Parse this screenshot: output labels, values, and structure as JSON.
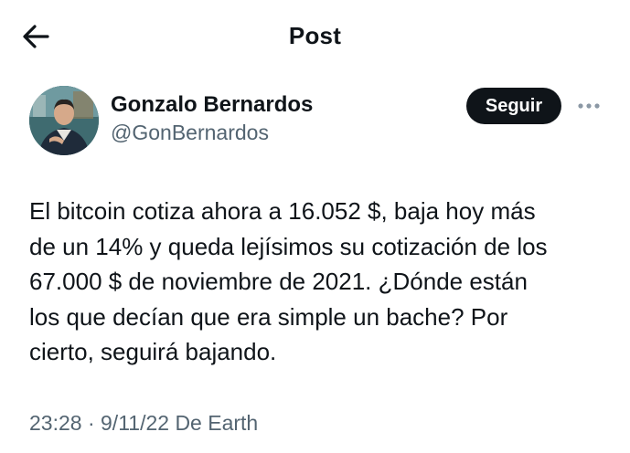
{
  "header": {
    "title": "Post",
    "back_icon": "arrow-left-icon"
  },
  "author": {
    "display_name": "Gonzalo Bernardos",
    "handle": "@GonBernardos",
    "follow_label": "Seguir",
    "more_icon": "more-horizontal-icon"
  },
  "post": {
    "text": "El bitcoin cotiza ahora a 16.052 $, baja hoy más\nde un 14% y queda lejísimos su cotización de los\n67.000 $ de noviembre de 2021. ¿Dónde están\nlos que decían que era simple un bache? Por\ncierto, seguirá bajando.",
    "time": "23:28",
    "separator": " · ",
    "date": "9/11/22",
    "source": "De Earth"
  },
  "colors": {
    "text_primary": "#0f1419",
    "text_secondary": "#536471",
    "follow_bg": "#0f1419",
    "follow_text": "#ffffff",
    "background": "#ffffff"
  }
}
